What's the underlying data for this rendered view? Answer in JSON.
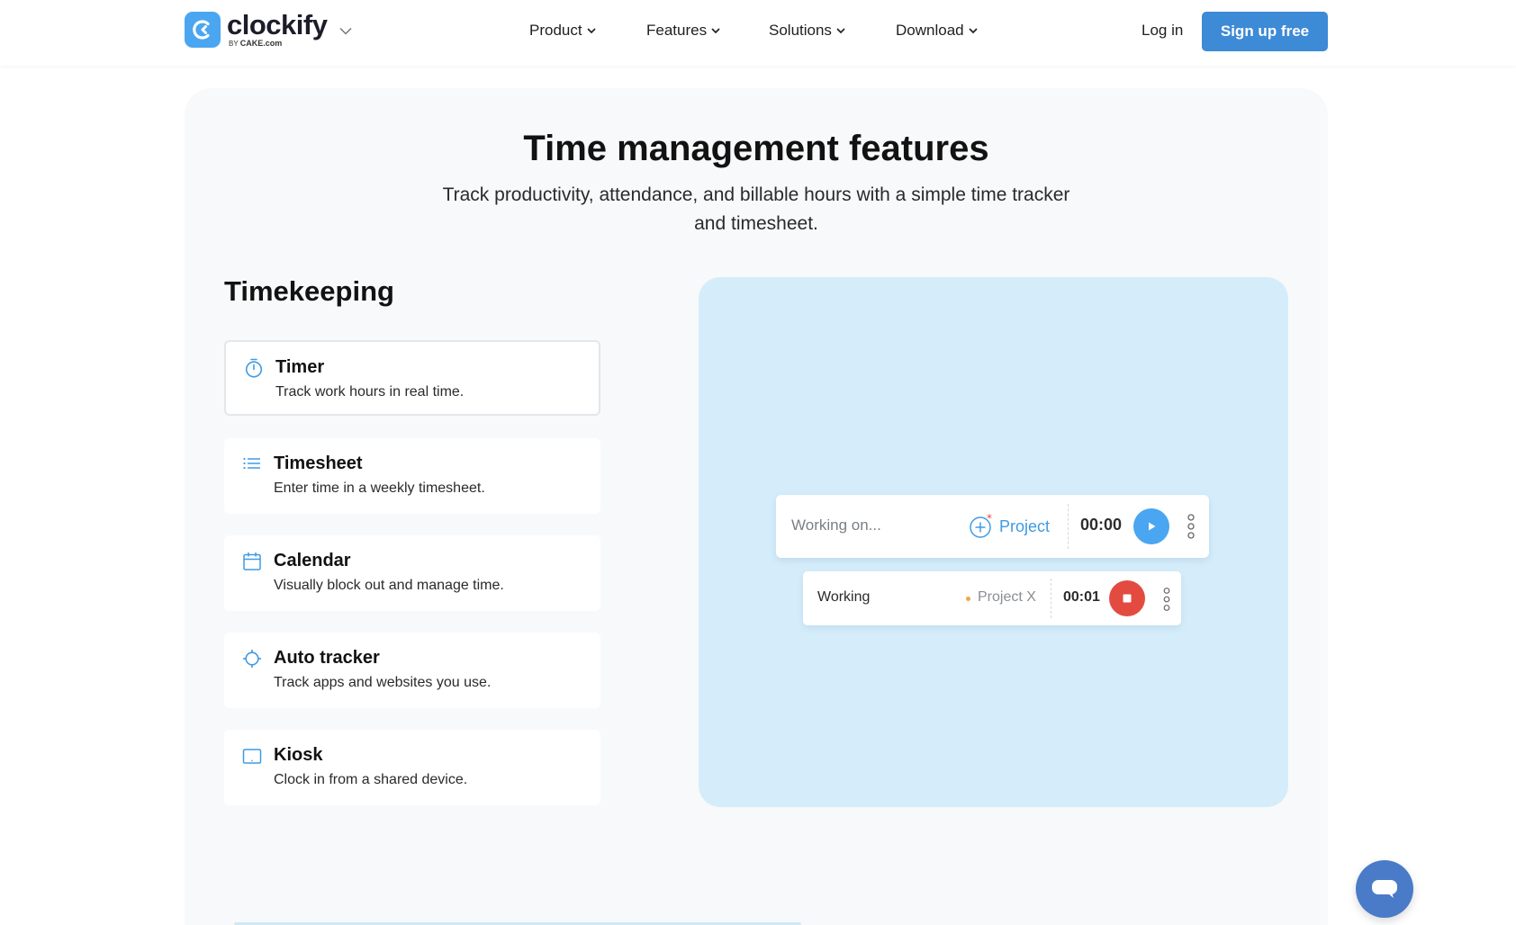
{
  "brand": {
    "name": "clockify",
    "by_prefix": "BY",
    "by_company": "CAKE.com",
    "color": "#4aa6f0"
  },
  "nav": {
    "items": [
      {
        "label": "Product"
      },
      {
        "label": "Features"
      },
      {
        "label": "Solutions"
      },
      {
        "label": "Download"
      }
    ],
    "login": "Log in",
    "signup": "Sign up free"
  },
  "hero": {
    "title": "Time management features",
    "subtitle": "Track productivity, attendance, and billable hours with a simple time tracker and timesheet."
  },
  "timekeeping": {
    "heading": "Timekeeping",
    "features": [
      {
        "title": "Timer",
        "desc": "Track work hours in real time.",
        "icon": "stopwatch-icon",
        "active": true
      },
      {
        "title": "Timesheet",
        "desc": "Enter time in a weekly timesheet.",
        "icon": "list-icon",
        "active": false
      },
      {
        "title": "Calendar",
        "desc": "Visually block out and manage time.",
        "icon": "calendar-icon",
        "active": false
      },
      {
        "title": "Auto tracker",
        "desc": "Track apps and websites you use.",
        "icon": "crosshair-icon",
        "active": false
      },
      {
        "title": "Kiosk",
        "desc": "Clock in from a shared device.",
        "icon": "tablet-icon",
        "active": false
      }
    ]
  },
  "demo": {
    "timer_bar": {
      "placeholder": "Working on...",
      "project_label": "Project",
      "time": "00:00"
    },
    "entry": {
      "description": "Working",
      "project": "Project X",
      "time": "00:01"
    }
  },
  "colors": {
    "accent": "#3d8ad6",
    "panel": "#d5edfb",
    "stop": "#e34b40",
    "play": "#4aa6f0"
  }
}
